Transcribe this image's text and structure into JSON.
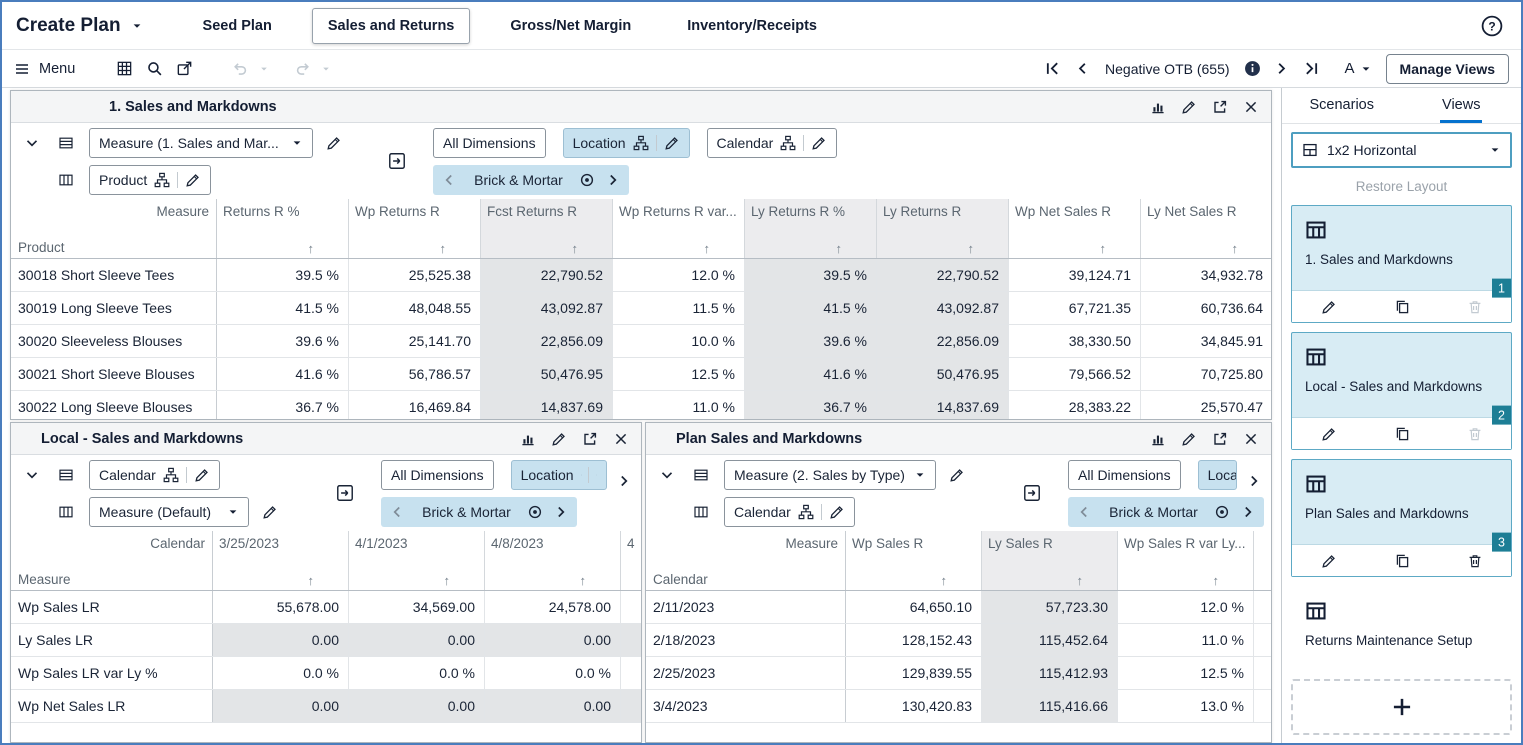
{
  "topbar": {
    "create_plan": "Create Plan",
    "tabs": [
      {
        "label": "Seed Plan",
        "selected": false
      },
      {
        "label": "Sales and Returns",
        "selected": true
      },
      {
        "label": "Gross/Net Margin",
        "selected": false
      },
      {
        "label": "Inventory/Receipts",
        "selected": false
      }
    ]
  },
  "toolbar": {
    "menu": "Menu",
    "alert_label": "Negative OTB (655)",
    "format_label": "A",
    "manage_views": "Manage Views"
  },
  "main_panel": {
    "title": "1. Sales and Markdowns",
    "row1": {
      "measure_dropdown": "Measure (1. Sales and Mar...",
      "all_dimensions": "All Dimensions",
      "location": "Location",
      "calendar": "Calendar"
    },
    "row2": {
      "product": "Product",
      "chip": "Brick & Mortar"
    },
    "table": {
      "corner": "Measure",
      "axis": "Product",
      "columns": [
        "Returns R %",
        "Wp Returns R",
        "Fcst Returns R",
        "Wp Returns R var...",
        "Ly Returns R %",
        "Ly Returns R",
        "Wp Net Sales R",
        "Ly Net Sales R"
      ],
      "readonly_cols": [
        2,
        4,
        5
      ],
      "rows": [
        {
          "label": "30018 Short Sleeve Tees",
          "cells": [
            "39.5 %",
            "25,525.38",
            "22,790.52",
            "12.0 %",
            "39.5 %",
            "22,790.52",
            "39,124.71",
            "34,932.78"
          ]
        },
        {
          "label": "30019 Long Sleeve Tees",
          "cells": [
            "41.5 %",
            "48,048.55",
            "43,092.87",
            "11.5 %",
            "41.5 %",
            "43,092.87",
            "67,721.35",
            "60,736.64"
          ]
        },
        {
          "label": "30020 Sleeveless Blouses",
          "cells": [
            "39.6 %",
            "25,141.70",
            "22,856.09",
            "10.0 %",
            "39.6 %",
            "22,856.09",
            "38,330.50",
            "34,845.91"
          ]
        },
        {
          "label": "30021 Short Sleeve Blouses",
          "cells": [
            "41.6 %",
            "56,786.57",
            "50,476.95",
            "12.5 %",
            "41.6 %",
            "50,476.95",
            "79,566.52",
            "70,725.80"
          ]
        },
        {
          "label": "30022 Long Sleeve Blouses",
          "cells": [
            "36.7 %",
            "16,469.84",
            "14,837.69",
            "11.0 %",
            "36.7 %",
            "14,837.69",
            "28,383.22",
            "25,570.47"
          ]
        }
      ]
    }
  },
  "local_panel": {
    "title": "Local - Sales and Markdowns",
    "row1": {
      "calendar": "Calendar",
      "all_dimensions": "All Dimensions",
      "location": "Location"
    },
    "row2": {
      "measure_dropdown": "Measure (Default)",
      "chip": "Brick & Mortar"
    },
    "table": {
      "corner": "Calendar",
      "axis": "Measure",
      "columns": [
        "3/25/2023",
        "4/1/2023",
        "4/8/2023",
        "4"
      ],
      "readonly_rows": [
        1,
        3
      ],
      "rows": [
        {
          "label": "Wp Sales LR",
          "cells": [
            "55,678.00",
            "34,569.00",
            "24,578.00",
            ""
          ]
        },
        {
          "label": "Ly Sales LR",
          "cells": [
            "0.00",
            "0.00",
            "0.00",
            ""
          ]
        },
        {
          "label": "Wp Sales LR var Ly %",
          "cells": [
            "0.0 %",
            "0.0 %",
            "0.0 %",
            ""
          ]
        },
        {
          "label": "Wp Net Sales LR",
          "cells": [
            "0.00",
            "0.00",
            "0.00",
            ""
          ]
        }
      ]
    }
  },
  "plan_panel": {
    "title": "Plan Sales and Markdowns",
    "row1": {
      "measure_dropdown": "Measure (2. Sales by Type)",
      "all_dimensions": "All Dimensions",
      "location": "Location"
    },
    "row2": {
      "calendar": "Calendar",
      "chip": "Brick & Mortar"
    },
    "table": {
      "corner": "Measure",
      "axis": "Calendar",
      "columns": [
        "Wp Sales R",
        "Ly Sales R",
        "Wp Sales R var Ly..."
      ],
      "readonly_cols": [
        1
      ],
      "rows": [
        {
          "label": "2/11/2023",
          "cells": [
            "64,650.10",
            "57,723.30",
            "12.0 %"
          ]
        },
        {
          "label": "2/18/2023",
          "cells": [
            "128,152.43",
            "115,452.64",
            "11.0 %"
          ]
        },
        {
          "label": "2/25/2023",
          "cells": [
            "129,839.55",
            "115,412.93",
            "12.5 %"
          ]
        },
        {
          "label": "3/4/2023",
          "cells": [
            "130,420.83",
            "115,416.66",
            "13.0 %"
          ]
        }
      ]
    }
  },
  "sidebar": {
    "tabs": [
      {
        "label": "Scenarios",
        "selected": false
      },
      {
        "label": "Views",
        "selected": true
      }
    ],
    "layout_select": "1x2 Horizontal",
    "restore_layout": "Restore Layout",
    "cards": [
      {
        "label": "1. Sales and Markdowns",
        "badge": "1",
        "active": true
      },
      {
        "label": "Local - Sales and Markdowns",
        "badge": "2",
        "active": true
      },
      {
        "label": "Plan Sales and Markdowns",
        "badge": "3",
        "active": true
      },
      {
        "label": "Returns Maintenance Setup",
        "badge": "",
        "active": false
      }
    ]
  },
  "icons": {
    "sort_asc": "↑",
    "help": "?",
    "info": "i"
  },
  "colors": {
    "accent": "#0572ce",
    "frame_blue": "#4a7dbd",
    "chip_blue": "#c7e1ef",
    "card_blue": "#d8ecf4",
    "badge_teal": "#1d7e95",
    "readonly_gray": "#e3e5e7"
  }
}
